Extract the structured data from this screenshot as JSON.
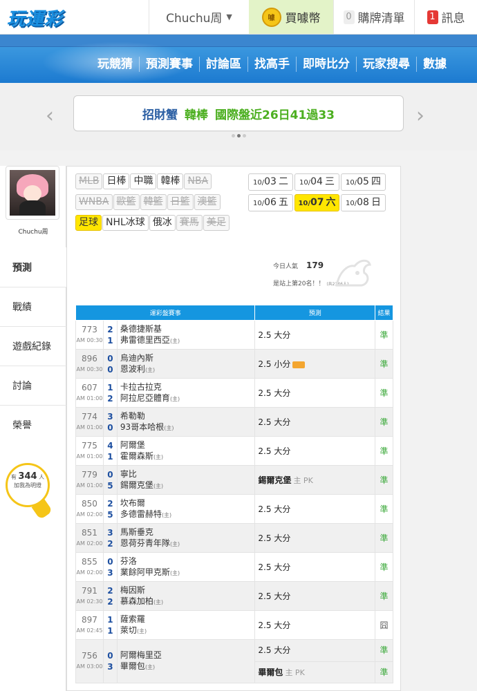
{
  "header": {
    "logo": "玩運彩",
    "user": "Chuchu周",
    "buy_label": "買噱幣",
    "coin_glyph": "噱",
    "cart_count": "0",
    "cart_label": "購牌清單",
    "msg_count": "1",
    "msg_label": "訊息"
  },
  "nav": [
    "玩競猜",
    "預測賽事",
    "討論區",
    "找高手",
    "即時比分",
    "玩家搜尋",
    "數據"
  ],
  "banner": {
    "title": "招財蟹",
    "sport": "韓棒",
    "text": "國際盤近26日41過33",
    "prev": "‹",
    "next": "›"
  },
  "profile": {
    "username": "Chuchu周",
    "nav": [
      "預測",
      "戰績",
      "遊戲紀錄",
      "討論",
      "榮譽"
    ],
    "fans_prefix": "有",
    "fans_count": "344",
    "fans_suffix": "人",
    "fans_text": "加我為明燈"
  },
  "sports": [
    {
      "label": "MLB",
      "state": "disabled"
    },
    {
      "label": "日棒",
      "state": "normal"
    },
    {
      "label": "中職",
      "state": "normal"
    },
    {
      "label": "韓棒",
      "state": "normal"
    },
    {
      "label": "NBA",
      "state": "disabled"
    },
    {
      "label": "WNBA",
      "state": "disabled"
    },
    {
      "label": "歐籃",
      "state": "disabled"
    },
    {
      "label": "韓籃",
      "state": "disabled"
    },
    {
      "label": "日籃",
      "state": "disabled"
    },
    {
      "label": "澳籃",
      "state": "disabled"
    },
    {
      "label": "足球",
      "state": "active"
    },
    {
      "label": "NHL冰球",
      "state": "normal"
    },
    {
      "label": "俄冰",
      "state": "normal"
    },
    {
      "label": "賽馬",
      "state": "disabled"
    },
    {
      "label": "美足",
      "state": "disabled"
    }
  ],
  "dates": [
    {
      "md": "10/",
      "d": "03",
      "wd": "二",
      "active": false
    },
    {
      "md": "10/",
      "d": "04",
      "wd": "三",
      "active": false
    },
    {
      "md": "10/",
      "d": "05",
      "wd": "四",
      "active": false
    },
    {
      "md": "10/",
      "d": "06",
      "wd": "五",
      "active": false
    },
    {
      "md": "10/",
      "d": "07",
      "wd": "六",
      "active": true
    },
    {
      "md": "10/",
      "d": "08",
      "wd": "日",
      "active": false
    }
  ],
  "stats": {
    "popularity_label": "今日人氣",
    "popularity": "179",
    "rank_text": "是站上第20名！！",
    "rank_small": "(共2346人)"
  },
  "table": {
    "headers": [
      "運彩盤賽事",
      "預測",
      "結果"
    ],
    "home_mark": "(主)",
    "rows": [
      {
        "id": "773",
        "time": "AM 00:30",
        "s1": "2",
        "t1": "桑德捷斯基",
        "s2": "1",
        "t2": "弗雷德里西亞",
        "pred": "2.5 大分",
        "res": "準"
      },
      {
        "id": "896",
        "time": "AM 00:30",
        "s1": "0",
        "t1": "烏迪內斯",
        "s2": "0",
        "t2": "恩波利",
        "pred": "2.5 小分",
        "hot": true,
        "res": "準"
      },
      {
        "id": "607",
        "time": "AM 01:00",
        "s1": "1",
        "t1": "卡拉古拉克",
        "s2": "2",
        "t2": "阿拉尼亞體育",
        "pred": "2.5 大分",
        "res": "準"
      },
      {
        "id": "774",
        "time": "AM 01:00",
        "s1": "3",
        "t1": "希勒勒",
        "s2": "0",
        "t2": "93哥本哈根",
        "pred": "2.5 大分",
        "res": "準"
      },
      {
        "id": "775",
        "time": "AM 01:00",
        "s1": "4",
        "t1": "阿爾堡",
        "s2": "1",
        "t2": "霍爾森斯",
        "pred": "2.5 大分",
        "res": "準"
      },
      {
        "id": "779",
        "time": "AM 01:00",
        "s1": "0",
        "t1": "寧比",
        "s2": "5",
        "t2": "錫爾克堡",
        "pred": "錫爾克堡",
        "pred_tag": "主 PK",
        "bold": true,
        "res": "準"
      },
      {
        "id": "850",
        "time": "AM 02:00",
        "s1": "2",
        "t1": "坎布爾",
        "s2": "5",
        "t2": "多德雷赫特",
        "pred": "2.5 大分",
        "res": "準"
      },
      {
        "id": "851",
        "time": "AM 02:00",
        "s1": "3",
        "t1": "馬斯垂克",
        "s2": "2",
        "t2": "恩荷芬青年隊",
        "pred": "2.5 大分",
        "res": "準"
      },
      {
        "id": "855",
        "time": "AM 02:00",
        "s1": "0",
        "t1": "芬洛",
        "s2": "3",
        "t2": "業餘阿甲克斯",
        "pred": "2.5 大分",
        "res": "準"
      },
      {
        "id": "791",
        "time": "AM 02:30",
        "s1": "2",
        "t1": "梅因斯",
        "s2": "2",
        "t2": "慕森加柏",
        "pred": "2.5 大分",
        "res": "準"
      },
      {
        "id": "897",
        "time": "AM 02:45",
        "s1": "1",
        "t1": "薩索羅",
        "s2": "1",
        "t2": "萊切",
        "pred": "2.5 大分",
        "res": "囧",
        "miss": true
      },
      {
        "id": "756",
        "time": "AM 03:00",
        "s1": "0",
        "t1": "阿爾梅里亞",
        "s2": "3",
        "t2": "畢爾包",
        "pred": "2.5 大分",
        "res": "準",
        "pred2": "畢爾包",
        "pred2_tag": "主 PK",
        "res2": "準"
      }
    ]
  }
}
